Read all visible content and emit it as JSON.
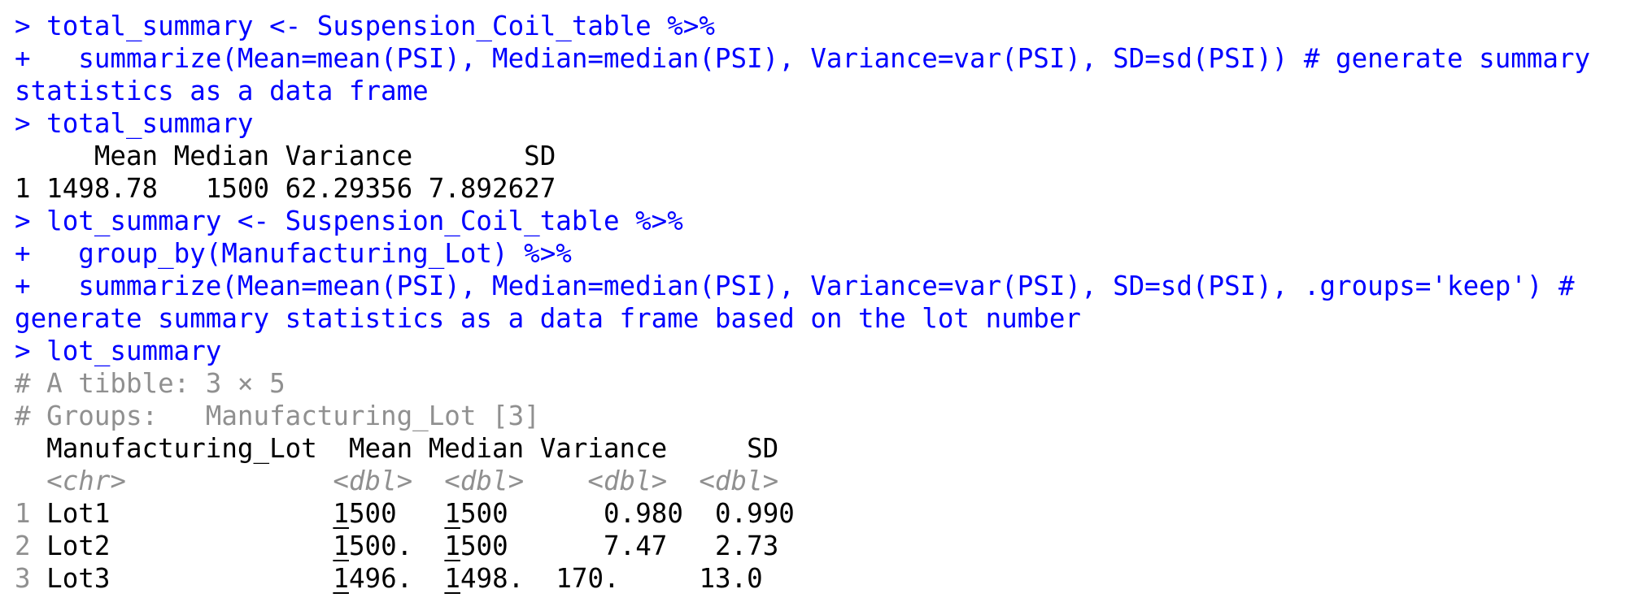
{
  "console": {
    "lines": [
      {
        "kind": "input",
        "text": "> total_summary <- Suspension_Coil_table %>%"
      },
      {
        "kind": "input",
        "text": "+   summarize(Mean=mean(PSI), Median=median(PSI), Variance=var(PSI), SD=sd(PSI)) # generate summary"
      },
      {
        "kind": "input",
        "text": "statistics as a data frame"
      },
      {
        "kind": "input",
        "text": "> total_summary"
      },
      {
        "kind": "output",
        "text": "     Mean Median Variance       SD"
      },
      {
        "kind": "output",
        "text": "1 1498.78   1500 62.29356 7.892627"
      },
      {
        "kind": "input",
        "text": "> lot_summary <- Suspension_Coil_table %>%"
      },
      {
        "kind": "input",
        "text": "+   group_by(Manufacturing_Lot) %>%"
      },
      {
        "kind": "input",
        "text": "+   summarize(Mean=mean(PSI), Median=median(PSI), Variance=var(PSI), SD=sd(PSI), .groups='keep') #"
      },
      {
        "kind": "input",
        "text": "generate summary statistics as a data frame based on the lot number"
      },
      {
        "kind": "input",
        "text": "> lot_summary"
      },
      {
        "kind": "comment",
        "text": "# A tibble: 3 × 5"
      },
      {
        "kind": "comment",
        "text": "# Groups:   Manufacturing_Lot [3]"
      }
    ],
    "tibble": {
      "header": "  Manufacturing_Lot  Mean Median Variance     SD",
      "types": "  <chr>             <dbl>  <dbl>    <dbl>  <dbl>",
      "rows": [
        {
          "idx": "1",
          "lot": "Lot1",
          "mean_first": "1",
          "mean_rest": "500  ",
          "median_first": "1",
          "median_rest": "500",
          "rest": "      0.980  0.990"
        },
        {
          "idx": "2",
          "lot": "Lot2",
          "mean_first": "1",
          "mean_rest": "500. ",
          "median_first": "1",
          "median_rest": "500",
          "rest": "      7.47   2.73"
        },
        {
          "idx": "3",
          "lot": "Lot3",
          "mean_first": "1",
          "mean_rest": "496. ",
          "median_first": "1",
          "median_rest": "498.",
          "rest": "  170.     13.0"
        }
      ]
    },
    "colors": {
      "input": "#0000ff",
      "output": "#000000",
      "comment": "#909090"
    }
  }
}
